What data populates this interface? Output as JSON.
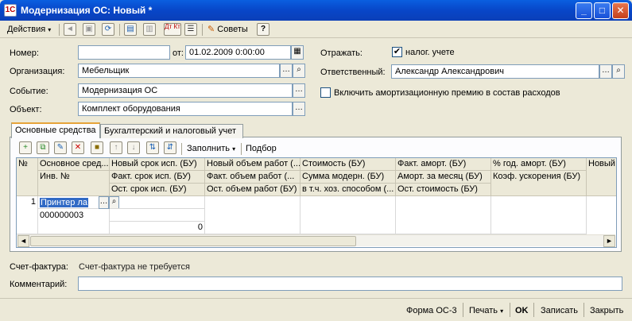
{
  "window": {
    "title": "Модернизация ОС: Новый *",
    "minimize": "_",
    "maximize": "□",
    "close": "✕"
  },
  "toolbar": {
    "actions_label": "Действия",
    "advice_label": "Советы",
    "help_label": "?",
    "dtkt_label": "Дт Кт"
  },
  "form": {
    "number_label": "Номер:",
    "number_value": "",
    "from_label": "от:",
    "date_value": "01.02.2009 0:00:00",
    "org_label": "Организация:",
    "org_value": "Мебельщик",
    "event_label": "Событие:",
    "event_value": "Модернизация ОС",
    "object_label": "Объект:",
    "object_value": "Комплект оборудования",
    "reflect_label": "Отражать:",
    "tax_label": "налог. учете",
    "responsible_label": "Ответственный:",
    "responsible_value": "Александр Александрович",
    "bonus_label": "Включить амортизационную премию в состав расходов"
  },
  "tabs": [
    {
      "label": "Основные средства"
    },
    {
      "label": "Бухгалтерский и налоговый учет"
    }
  ],
  "table_toolbar": {
    "fill_label": "Заполнить",
    "select_label": "Подбор"
  },
  "table": {
    "header_row1": [
      "№",
      "Основное сред...",
      "Новый срок исп. (БУ)",
      "Новый объем работ (...",
      "Стоимость (БУ)",
      "Факт. аморт. (БУ)",
      "% год. аморт. (БУ)",
      "Новый"
    ],
    "header_row2": [
      "Инв. №",
      "Факт. срок исп. (БУ)",
      "Факт. объем работ (...",
      "Сумма модерн. (БУ)",
      "Аморт. за месяц (БУ)",
      "Коэф. ускорения (БУ)"
    ],
    "header_row3": [
      "Ост. срок исп. (БУ)",
      "Ост. объем работ (БУ)",
      "в т.ч. хоз. способом (...",
      "Ост. стоимость (БУ)"
    ],
    "row": {
      "num": "1",
      "asset": "Принтер ла",
      "inv": "000000003",
      "remaining_value": "0"
    }
  },
  "invoice": {
    "label": "Счет-фактура:",
    "value": "Счет-фактура не требуется"
  },
  "comment": {
    "label": "Комментарий:",
    "value": ""
  },
  "bottom": {
    "form_label": "Форма ОС-3",
    "print_label": "Печать",
    "ok_label": "OK",
    "save_label": "Записать",
    "close_label": "Закрыть"
  }
}
